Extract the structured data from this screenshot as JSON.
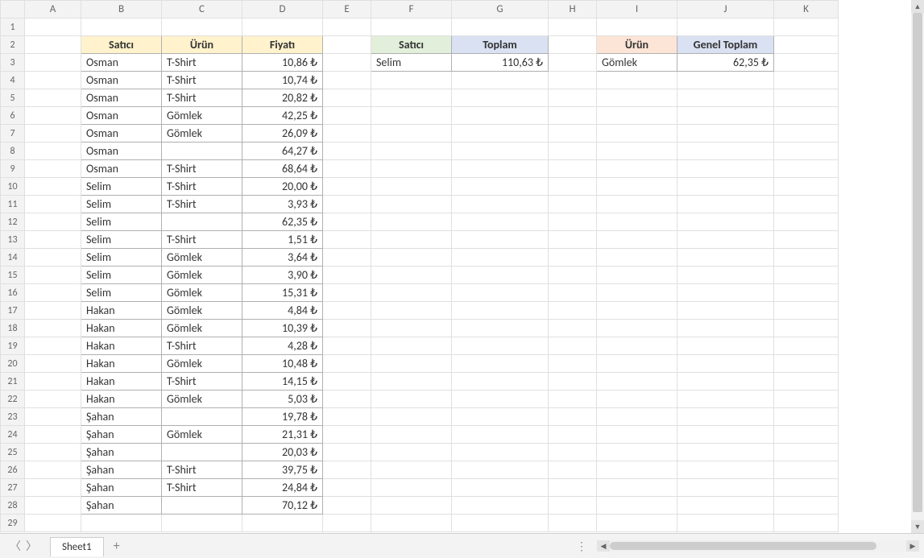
{
  "columns": [
    "A",
    "B",
    "C",
    "D",
    "E",
    "F",
    "G",
    "H",
    "I",
    "J",
    "K"
  ],
  "rowCount": 29,
  "table1": {
    "headers": {
      "seller": "Satıcı",
      "product": "Ürün",
      "price": "Fiyatı"
    },
    "rows": [
      {
        "seller": "Osman",
        "product": "T-Shirt",
        "price": "10,86 ₺"
      },
      {
        "seller": "Osman",
        "product": "T-Shirt",
        "price": "10,74 ₺"
      },
      {
        "seller": "Osman",
        "product": "T-Shirt",
        "price": "20,82 ₺"
      },
      {
        "seller": "Osman",
        "product": "Gömlek",
        "price": "42,25 ₺"
      },
      {
        "seller": "Osman",
        "product": "Gömlek",
        "price": "26,09 ₺"
      },
      {
        "seller": "Osman",
        "product": "",
        "price": "64,27 ₺"
      },
      {
        "seller": "Osman",
        "product": "T-Shirt",
        "price": "68,64 ₺"
      },
      {
        "seller": "Selim",
        "product": "T-Shirt",
        "price": "20,00 ₺"
      },
      {
        "seller": "Selim",
        "product": "T-Shirt",
        "price": "3,93 ₺"
      },
      {
        "seller": "Selim",
        "product": "",
        "price": "62,35 ₺"
      },
      {
        "seller": "Selim",
        "product": "T-Shirt",
        "price": "1,51 ₺"
      },
      {
        "seller": "Selim",
        "product": "Gömlek",
        "price": "3,64 ₺"
      },
      {
        "seller": "Selim",
        "product": "Gömlek",
        "price": "3,90 ₺"
      },
      {
        "seller": "Selim",
        "product": "Gömlek",
        "price": "15,31 ₺"
      },
      {
        "seller": "Hakan",
        "product": "Gömlek",
        "price": "4,84 ₺"
      },
      {
        "seller": "Hakan",
        "product": "Gömlek",
        "price": "10,39 ₺"
      },
      {
        "seller": "Hakan",
        "product": "T-Shirt",
        "price": "4,28 ₺"
      },
      {
        "seller": "Hakan",
        "product": "Gömlek",
        "price": "10,48 ₺"
      },
      {
        "seller": "Hakan",
        "product": "T-Shirt",
        "price": "14,15 ₺"
      },
      {
        "seller": "Hakan",
        "product": "Gömlek",
        "price": "5,03 ₺"
      },
      {
        "seller": "Şahan",
        "product": "",
        "price": "19,78 ₺"
      },
      {
        "seller": "Şahan",
        "product": "Gömlek",
        "price": "21,31 ₺"
      },
      {
        "seller": "Şahan",
        "product": "",
        "price": "20,03 ₺"
      },
      {
        "seller": "Şahan",
        "product": "T-Shirt",
        "price": "39,75 ₺"
      },
      {
        "seller": "Şahan",
        "product": "T-Shirt",
        "price": "24,84 ₺"
      },
      {
        "seller": "Şahan",
        "product": "",
        "price": "70,12 ₺"
      }
    ]
  },
  "table2": {
    "headers": {
      "seller": "Satıcı",
      "total": "Toplam"
    },
    "rows": [
      {
        "seller": "Selim",
        "total": "110,63 ₺"
      }
    ]
  },
  "table3": {
    "headers": {
      "product": "Ürün",
      "grandTotal": "Genel Toplam"
    },
    "rows": [
      {
        "product": "Gömlek",
        "grandTotal": "62,35 ₺"
      }
    ]
  },
  "sheetTab": "Sheet1"
}
